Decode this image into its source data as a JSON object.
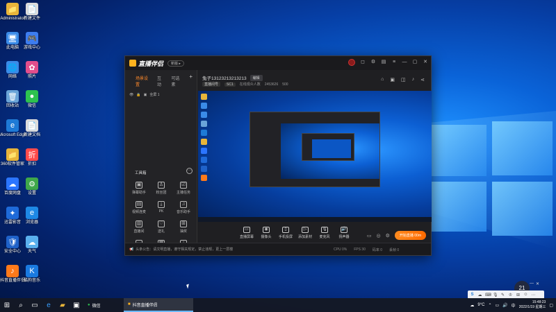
{
  "desktop": {
    "icons": [
      {
        "label": "Administrator",
        "glyph": "📁",
        "color": "#e8b53a"
      },
      {
        "label": "此电脑",
        "glyph": "🖥",
        "color": "#3a8be8"
      },
      {
        "label": "网络",
        "glyph": "🌐",
        "color": "#3a8be8"
      },
      {
        "label": "回收站",
        "glyph": "🗑",
        "color": "#6aa4d8"
      },
      {
        "label": "Microsoft Edge",
        "glyph": "e",
        "color": "#1e7ad6"
      },
      {
        "label": "360软件管家",
        "glyph": "📁",
        "color": "#e8b53a"
      },
      {
        "label": "百度网盘",
        "glyph": "☁",
        "color": "#2b75ff"
      },
      {
        "label": "迅雷影音",
        "glyph": "✦",
        "color": "#1e6ad9"
      },
      {
        "label": "安全中心",
        "glyph": "🛡",
        "color": "#1f62c9"
      },
      {
        "label": "抖音直播伴侣",
        "glyph": "♪",
        "color": "#ff7a1a"
      },
      {
        "label": "新建文件",
        "glyph": "📄",
        "color": "#dcdcdc"
      },
      {
        "label": "游戏中心",
        "glyph": "🎮",
        "color": "#3d7df0"
      },
      {
        "label": "照片",
        "glyph": "✿",
        "color": "#e24e8c"
      },
      {
        "label": "微信",
        "glyph": "●",
        "color": "#2dc24f"
      },
      {
        "label": "新建文档",
        "glyph": "📄",
        "color": "#dcdcdc"
      },
      {
        "label": "折扣",
        "glyph": "折",
        "color": "#ff4b4b"
      },
      {
        "label": "设置",
        "glyph": "⚙",
        "color": "#3fa84a"
      },
      {
        "label": "浏览器",
        "glyph": "e",
        "color": "#1e88e5"
      },
      {
        "label": "天气",
        "glyph": "☁",
        "color": "#5ab0ee"
      },
      {
        "label": "酷狗音乐",
        "glyph": "K",
        "color": "#1a7ae0"
      }
    ]
  },
  "app": {
    "logo_text": "直播伴侣",
    "version_badge": "新版 ▸",
    "left_tabs": [
      {
        "label": "场景设置",
        "active": true
      },
      {
        "label": "互动",
        "active": false
      },
      {
        "label": "可选素",
        "active": false
      }
    ],
    "scene_label": "全屏 1",
    "tools_title": "工具箱",
    "tools": [
      {
        "label": "弹幕助手",
        "glyph": "▣"
      },
      {
        "label": "粉丝团",
        "glyph": "♙"
      },
      {
        "label": "主播任务",
        "glyph": "☑"
      },
      {
        "label": "视频连麦",
        "glyph": "▤"
      },
      {
        "label": "PK",
        "glyph": "⤓"
      },
      {
        "label": "音乐助手",
        "glyph": "♫"
      },
      {
        "label": "直播间",
        "glyph": "▥"
      },
      {
        "label": "送礼",
        "glyph": "♡"
      },
      {
        "label": "抽奖",
        "glyph": "⊞"
      },
      {
        "label": "更多",
        "glyph": "⋯"
      },
      {
        "label": "录屏",
        "glyph": "▦"
      },
      {
        "label": "下载",
        "glyph": "⤓"
      }
    ],
    "room_title": "兔子13123213213213",
    "room_edit": "编辑",
    "room_meta": {
      "pill1": "直播间号",
      "pill2": "SC1",
      "label3": "在线观众人数",
      "fans": "2453626",
      "likes": "500"
    },
    "controls": [
      {
        "label": "直播屏幕",
        "glyph": "▭"
      },
      {
        "label": "摄像头",
        "glyph": "◉"
      },
      {
        "label": "手机投屏",
        "glyph": "▯"
      },
      {
        "label": "添加素材",
        "glyph": "▷"
      },
      {
        "label": "麦克风",
        "glyph": "🎙"
      },
      {
        "label": "扬声器",
        "glyph": "🔊"
      }
    ],
    "live_button": "开始直播 00m",
    "status_notice": "头条公告：请文明直播，遵守相关规定，禁止违规，更上一层楼",
    "status_stats": [
      "CPU 0%",
      "FPS 30",
      "码率 0",
      "丢帧 0"
    ]
  },
  "floating": {
    "temp": "21"
  },
  "taskbar": {
    "app1": "微信",
    "app2": "抖音直播伴侣",
    "weather": "9°C",
    "time": "15:48:23",
    "date": "2022/1/19 星期三"
  }
}
